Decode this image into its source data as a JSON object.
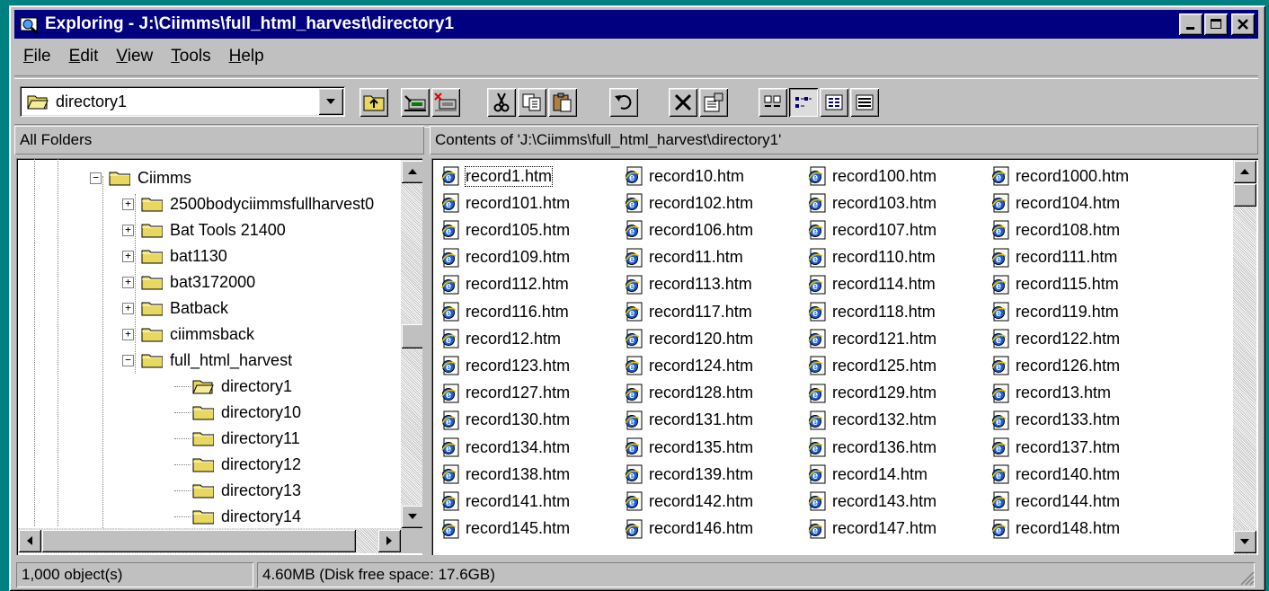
{
  "window": {
    "title": "Exploring - J:\\Ciimms\\full_html_harvest\\directory1",
    "controls": [
      "minimize",
      "maximize",
      "close"
    ]
  },
  "menu": [
    {
      "label": "File",
      "key": "F",
      "rest": "ile"
    },
    {
      "label": "Edit",
      "key": "E",
      "rest": "dit"
    },
    {
      "label": "View",
      "key": "V",
      "rest": "iew"
    },
    {
      "label": "Tools",
      "key": "T",
      "rest": "ools"
    },
    {
      "label": "Help",
      "key": "H",
      "rest": "elp"
    }
  ],
  "toolbar": {
    "address_value": "directory1",
    "buttons": [
      "up-one-level",
      "map-network-drive",
      "disconnect-network-drive",
      "cut",
      "copy",
      "paste",
      "undo",
      "delete",
      "properties",
      "large-icons",
      "small-icons",
      "list",
      "details"
    ],
    "active_view": "small-icons"
  },
  "panes": {
    "left_header": "All Folders",
    "right_header": "Contents of 'J:\\Ciimms\\full_html_harvest\\directory1'"
  },
  "tree": [
    {
      "label": "Ciimms",
      "level": 0,
      "toggle": "-",
      "open": false
    },
    {
      "label": "2500bodyciimmsfullharvest0",
      "level": 1,
      "toggle": "+",
      "open": false
    },
    {
      "label": "Bat Tools 21400",
      "level": 1,
      "toggle": "+",
      "open": false
    },
    {
      "label": "bat1130",
      "level": 1,
      "toggle": "+",
      "open": false
    },
    {
      "label": "bat3172000",
      "level": 1,
      "toggle": "+",
      "open": false
    },
    {
      "label": "Batback",
      "level": 1,
      "toggle": "+",
      "open": false
    },
    {
      "label": "ciimmsback",
      "level": 1,
      "toggle": "+",
      "open": false
    },
    {
      "label": "full_html_harvest",
      "level": 1,
      "toggle": "-",
      "open": false
    },
    {
      "label": "directory1",
      "level": 2,
      "toggle": "",
      "open": true
    },
    {
      "label": "directory10",
      "level": 2,
      "toggle": "",
      "open": false
    },
    {
      "label": "directory11",
      "level": 2,
      "toggle": "",
      "open": false
    },
    {
      "label": "directory12",
      "level": 2,
      "toggle": "",
      "open": false
    },
    {
      "label": "directory13",
      "level": 2,
      "toggle": "",
      "open": false
    },
    {
      "label": "directory14",
      "level": 2,
      "toggle": "",
      "open": false
    }
  ],
  "files": [
    "record1.htm",
    "record10.htm",
    "record100.htm",
    "record1000.htm",
    "record101.htm",
    "record102.htm",
    "record103.htm",
    "record104.htm",
    "record105.htm",
    "record106.htm",
    "record107.htm",
    "record108.htm",
    "record109.htm",
    "record11.htm",
    "record110.htm",
    "record111.htm",
    "record112.htm",
    "record113.htm",
    "record114.htm",
    "record115.htm",
    "record116.htm",
    "record117.htm",
    "record118.htm",
    "record119.htm",
    "record12.htm",
    "record120.htm",
    "record121.htm",
    "record122.htm",
    "record123.htm",
    "record124.htm",
    "record125.htm",
    "record126.htm",
    "record127.htm",
    "record128.htm",
    "record129.htm",
    "record13.htm",
    "record130.htm",
    "record131.htm",
    "record132.htm",
    "record133.htm",
    "record134.htm",
    "record135.htm",
    "record136.htm",
    "record137.htm",
    "record138.htm",
    "record139.htm",
    "record14.htm",
    "record140.htm",
    "record141.htm",
    "record142.htm",
    "record143.htm",
    "record144.htm",
    "record145.htm",
    "record146.htm",
    "record147.htm",
    "record148.htm"
  ],
  "focused_file": "record1.htm",
  "status": {
    "objects": "1,000 object(s)",
    "size": "4.60MB (Disk free space: 17.6GB)"
  },
  "colors": {
    "titlebar": "#000080",
    "face": "#c0c0c0",
    "desktop": "#008080",
    "folder": "#e8d860"
  }
}
